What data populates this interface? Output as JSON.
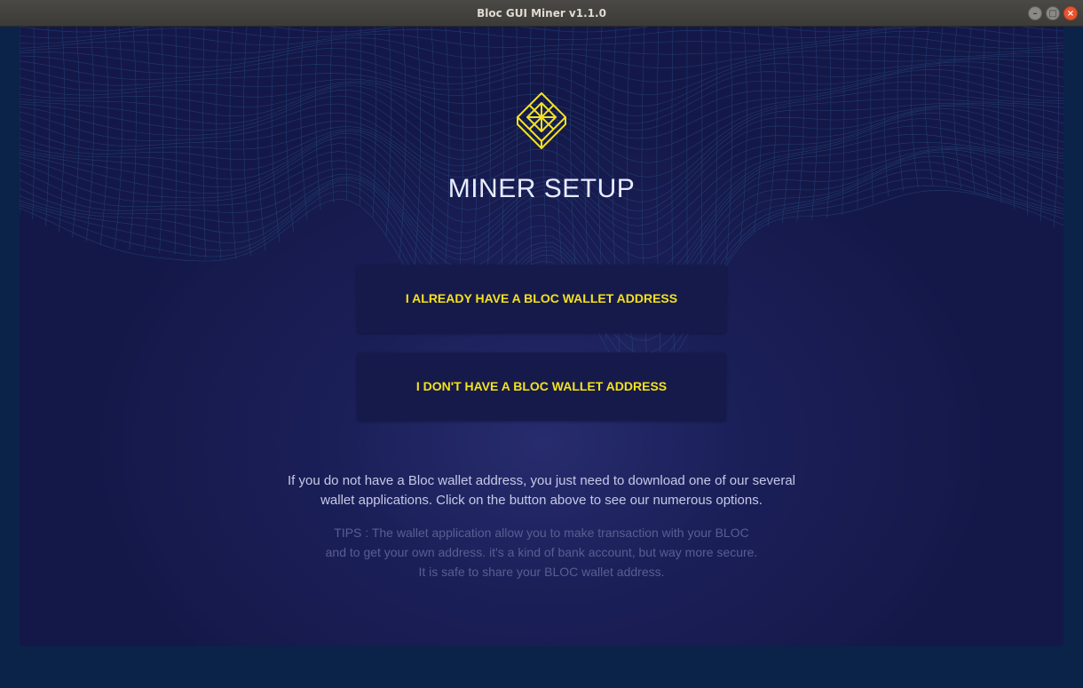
{
  "window": {
    "title": "Bloc GUI Miner v1.1.0"
  },
  "page": {
    "heading": "MINER SETUP",
    "logo": "bloc-cube-logo",
    "accent_color": "#f4e21b"
  },
  "buttons": {
    "have_wallet": "I ALREADY HAVE A BLOC WALLET ADDRESS",
    "no_wallet": "I DON'T HAVE A BLOC WALLET ADDRESS"
  },
  "info": {
    "line1": "If you do not have a Bloc wallet address, you just need to download one of our several",
    "line2": "wallet applications. Click on the button above to see our numerous options."
  },
  "tips": {
    "line1": "TIPS : The wallet application allow you to make transaction with your BLOC",
    "line2": "and to get your own address. it's a kind of bank account, but way more secure.",
    "line3": "It is safe to share your BLOC wallet address."
  }
}
